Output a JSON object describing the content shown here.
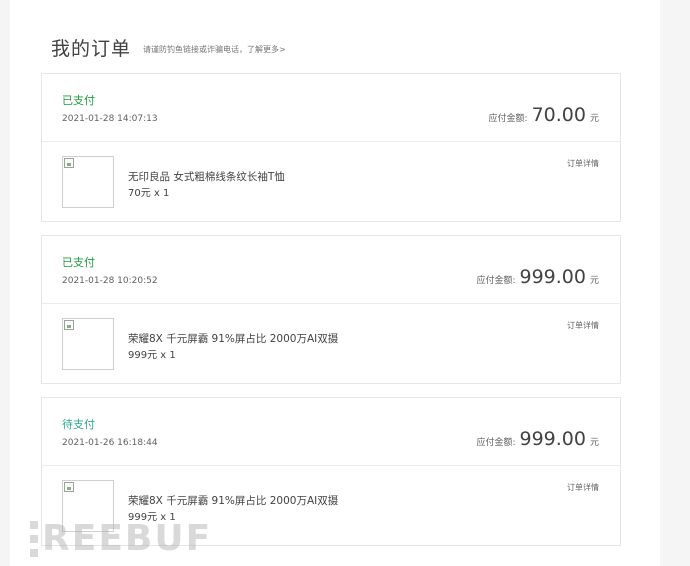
{
  "page": {
    "title": "我的订单",
    "note": "请谨防钓鱼链接或诈骗电话，了解更多>"
  },
  "orders": [
    {
      "status": "已支付",
      "time": "2021-01-28 14:07:13",
      "amount_label": "应付金额:",
      "amount_value": "70.00",
      "amount_unit": "元",
      "product_name": "无印良品 女式粗棉线条纹长袖T恤",
      "product_price": "70元 x 1",
      "detail_label": "订单详情"
    },
    {
      "status": "已支付",
      "time": "2021-01-28 10:20:52",
      "amount_label": "应付金额:",
      "amount_value": "999.00",
      "amount_unit": "元",
      "product_name": "荣耀8X 千元屏霸 91%屏占比 2000万AI双摄",
      "product_price": "999元 x 1",
      "detail_label": "订单详情"
    },
    {
      "status": "待支付",
      "time": "2021-01-26 16:18:44",
      "amount_label": "应付金额:",
      "amount_value": "999.00",
      "amount_unit": "元",
      "product_name": "荣耀8X 千元屏霸 91%屏占比 2000万AI双摄",
      "product_price": "999元 x 1",
      "detail_label": "订单详情"
    }
  ],
  "colors": {
    "paid_status": "#1f9c3e",
    "pending_status": "#2fa88f"
  },
  "watermark": "REEBUF"
}
